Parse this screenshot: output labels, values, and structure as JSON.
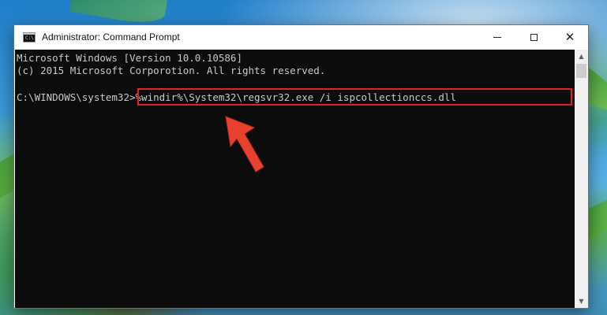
{
  "window": {
    "title": "Administrator: Command Prompt",
    "app_icon_text": "C:\\"
  },
  "controls": {
    "minimize": "minimize",
    "maximize": "maximize",
    "close": "close"
  },
  "console": {
    "line1": "Microsoft Windows [Version 10.0.10586]",
    "line2": "(c) 2015 Microsoft Corporotion. All rights reserved.",
    "prompt": "C:\\WINDOWS\\system32>",
    "command": "%windir%\\System32\\regsvr32.exe /i ispcollectionccs.dll"
  },
  "colors": {
    "highlight": "#e02424",
    "arrow": "#e8412f",
    "console_bg": "#0c0c0c",
    "console_text": "#c8c8c8"
  },
  "icons": {
    "app": "cmd-icon",
    "minimize": "minimize-icon",
    "maximize": "maximize-icon",
    "close": "close-icon",
    "scroll_up": "scroll-up-arrow-icon",
    "scroll_down": "scroll-down-arrow-icon",
    "pointer": "red-arrow-annotation-icon"
  }
}
